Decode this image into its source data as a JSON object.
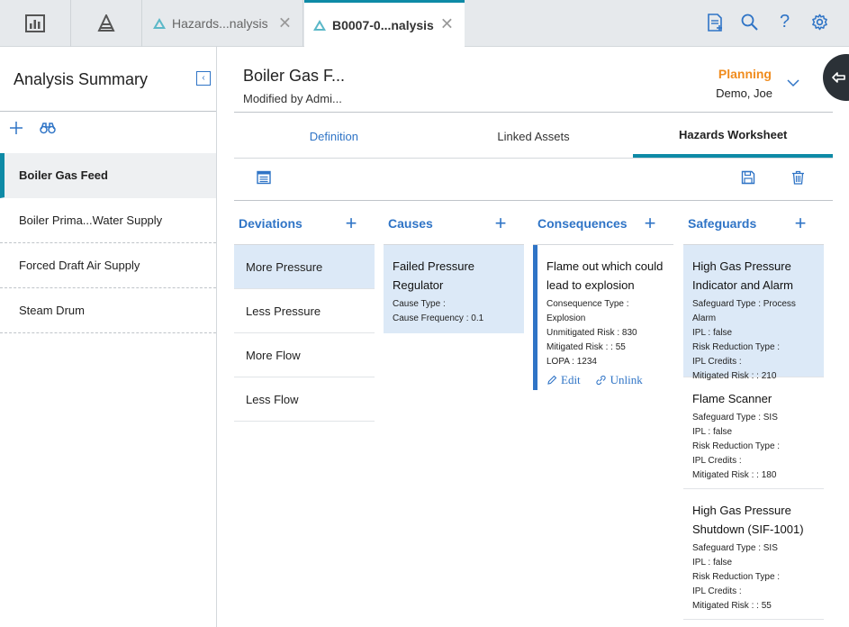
{
  "tabs": [
    {
      "label": "Hazards...nalysis"
    },
    {
      "label": "B0007-0...nalysis"
    }
  ],
  "left_panel": {
    "title": "Analysis Summary",
    "items": [
      {
        "label": "Boiler Gas Feed"
      },
      {
        "label": "Boiler Prima...Water Supply"
      },
      {
        "label": "Forced Draft Air Supply"
      },
      {
        "label": "Steam Drum"
      }
    ]
  },
  "header": {
    "title": "Boiler Gas F...",
    "subtitle": "Modified by Admi...",
    "state": "Planning",
    "owner": "Demo, Joe"
  },
  "section_tabs": [
    {
      "label": "Definition"
    },
    {
      "label": "Linked Assets"
    },
    {
      "label": "Hazards Worksheet"
    }
  ],
  "columns": {
    "deviations": {
      "title": "Deviations",
      "items": [
        {
          "label": "More Pressure"
        },
        {
          "label": "Less Pressure"
        },
        {
          "label": "More Flow"
        },
        {
          "label": "Less Flow"
        }
      ]
    },
    "causes": {
      "title": "Causes",
      "items": [
        {
          "name": "Failed Pressure Regulator",
          "attrs": [
            "Cause Type :",
            "Cause Frequency : 0.1"
          ]
        }
      ]
    },
    "consequences": {
      "title": "Consequences",
      "items": [
        {
          "name": "Flame out which could lead to explosion",
          "attrs": [
            "Consequence Type : Explosion",
            "Unmitigated Risk : 830",
            "Mitigated Risk : : 55",
            "LOPA : 1234"
          ],
          "edit_label": "Edit",
          "unlink_label": "Unlink"
        }
      ]
    },
    "safeguards": {
      "title": "Safeguards",
      "items": [
        {
          "name": "High Gas Pressure Indicator and Alarm",
          "attrs": [
            "Safeguard Type : Process Alarm",
            "IPL : false",
            "Risk Reduction Type :",
            "IPL Credits :",
            "Mitigated Risk : : 210"
          ]
        },
        {
          "name": "Flame Scanner",
          "attrs": [
            "Safeguard Type : SIS",
            "IPL : false",
            "Risk Reduction Type :",
            "IPL Credits :",
            "Mitigated Risk : : 180"
          ]
        },
        {
          "name": "High Gas Pressure Shutdown (SIF-1001)",
          "attrs": [
            "Safeguard Type : SIS",
            "IPL : false",
            "Risk Reduction Type :",
            "IPL Credits :",
            "Mitigated Risk : : 55"
          ]
        }
      ]
    }
  },
  "colors": {
    "accent_teal": "#0e8aa6",
    "link_blue": "#2f74c6",
    "state_orange": "#f08c1e",
    "selection_bg": "#dce9f7"
  },
  "icons": [
    "dashboard-icon",
    "hazards-logo-icon",
    "close-icon",
    "add-document-icon",
    "search-icon",
    "help-icon",
    "gear-icon",
    "collapse-left-icon",
    "plus-icon",
    "binoculars-icon",
    "chevron-down-icon",
    "side-panel-icon",
    "list-view-icon",
    "save-icon",
    "trash-icon",
    "pencil-icon",
    "unlink-icon"
  ]
}
